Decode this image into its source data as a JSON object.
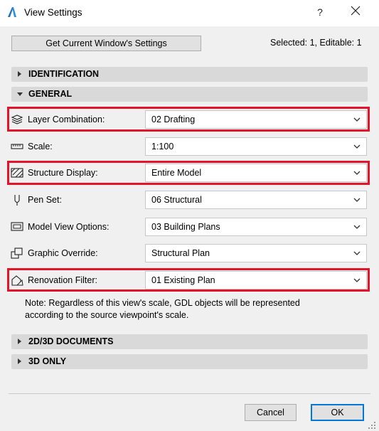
{
  "window": {
    "title": "View Settings",
    "help": "?"
  },
  "toolbar": {
    "get_settings_label": "Get Current Window's Settings",
    "selected_info": "Selected: 1, Editable: 1"
  },
  "sections": {
    "identification": "IDENTIFICATION",
    "general": "GENERAL",
    "docs_2d3d": "2D/3D DOCUMENTS",
    "only_3d": "3D ONLY"
  },
  "fields": {
    "layer_combination": {
      "label": "Layer Combination:",
      "value": "02 Drafting",
      "icon": "layers-icon"
    },
    "scale": {
      "label": "Scale:",
      "value": "1:100",
      "icon": "ruler-icon"
    },
    "structure_display": {
      "label": "Structure Display:",
      "value": "Entire Model",
      "icon": "structure-icon"
    },
    "pen_set": {
      "label": "Pen Set:",
      "value": "06 Structural",
      "icon": "pen-icon"
    },
    "model_view_options": {
      "label": "Model View Options:",
      "value": "03 Building Plans",
      "icon": "monitor-icon"
    },
    "graphic_override": {
      "label": "Graphic Override:",
      "value": "Structural Plan",
      "icon": "override-icon"
    },
    "renovation_filter": {
      "label": "Renovation Filter:",
      "value": "01 Existing Plan",
      "icon": "renovation-icon"
    }
  },
  "note": {
    "line1": "Note: Regardless of this view's scale, GDL objects will be represented",
    "line2": "according to the source viewpoint's scale."
  },
  "buttons": {
    "cancel": "Cancel",
    "ok": "OK"
  },
  "colors": {
    "highlight": "#e3132a",
    "section_bg": "#d9d9d9",
    "dialog_bg": "#f0f0f0",
    "ok_border": "#0078d7"
  }
}
